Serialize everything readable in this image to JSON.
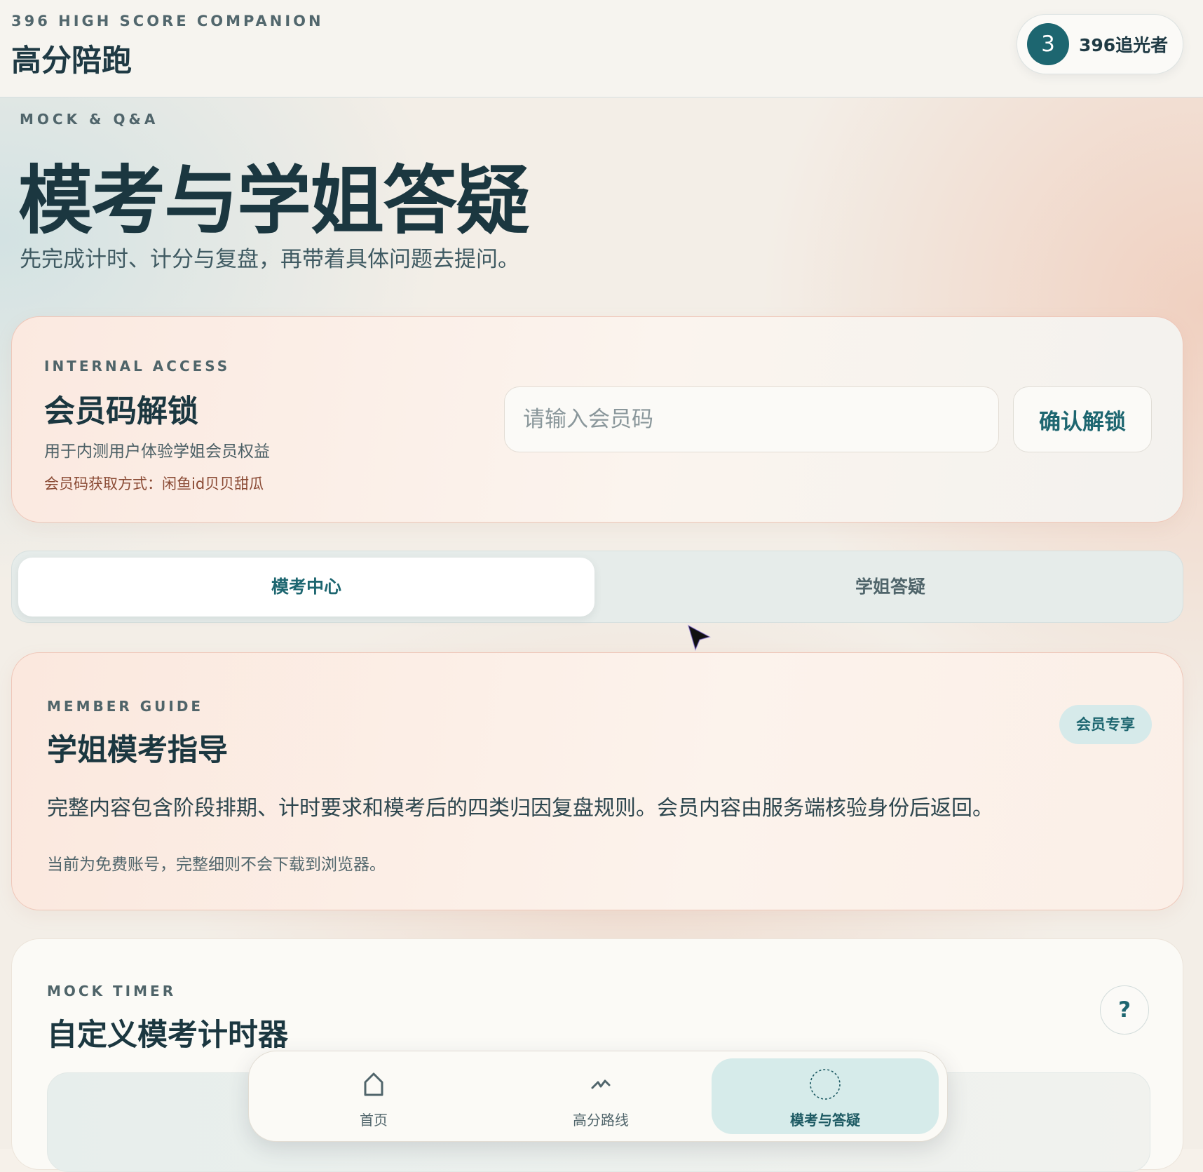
{
  "header": {
    "eyebrow": "396 HIGH SCORE COMPANION",
    "brand": "高分陪跑",
    "user": {
      "avatar_text": "3",
      "name": "396追光者"
    }
  },
  "hero": {
    "eyebrow": "MOCK & Q&A",
    "title": "模考与学姐答疑",
    "subtitle": "先完成计时、计分与复盘，再带着具体问题去提问。"
  },
  "access": {
    "eyebrow": "INTERNAL ACCESS",
    "title": "会员码解锁",
    "desc": "用于内测用户体验学姐会员权益",
    "hint": "会员码获取方式：闲鱼id贝贝甜瓜",
    "input_placeholder": "请输入会员码",
    "input_value": "",
    "button": "确认解锁"
  },
  "tabs": [
    {
      "label": "模考中心",
      "active": true
    },
    {
      "label": "学姐答疑",
      "active": false
    }
  ],
  "guide": {
    "eyebrow": "MEMBER GUIDE",
    "title": "学姐模考指导",
    "badge": "会员专享",
    "body": "完整内容包含阶段排期、计时要求和模考后的四类归因复盘规则。会员内容由服务端核验身份后返回。",
    "note": "当前为免费账号，完整细则不会下载到浏览器。"
  },
  "timer": {
    "eyebrow": "MOCK TIMER",
    "title": "自定义模考计时器",
    "help_label": "?"
  },
  "bottom_nav": [
    {
      "label": "首页",
      "icon": "home-icon",
      "active": false
    },
    {
      "label": "高分路线",
      "icon": "zigzag-route-icon",
      "active": false
    },
    {
      "label": "模考与答疑",
      "icon": "dashed-circle-icon",
      "active": true
    }
  ],
  "colors": {
    "accent": "#1d6670",
    "text": "#1b3740",
    "card_border": "#efc7b9",
    "hint_text": "#8a4a34",
    "badge_bg": "#d6eaea"
  }
}
